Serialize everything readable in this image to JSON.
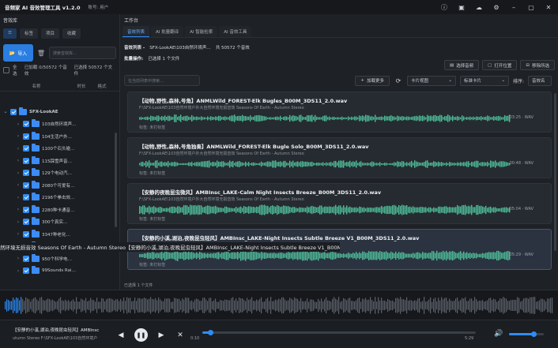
{
  "titlebar": {
    "title": "音频家 AI 音效管理工具 v1.2.0",
    "user": "账号: 用户",
    "icons": [
      "info-icon",
      "window-icon",
      "chat-icon",
      "gear-icon",
      "minimize-icon",
      "maximize-icon",
      "close-icon"
    ]
  },
  "left": {
    "panel_title": "音效库",
    "tabs": [
      "标签",
      "项目",
      "收藏"
    ],
    "import_label": "导入",
    "search_placeholder": "搜索音效库…",
    "select_all_label": "全选",
    "selection_info": "已加载 0/50572 个音效",
    "selection_info2": "已选择 50572 个文件",
    "columns": [
      "名称",
      "时长",
      "格式"
    ],
    "tree": {
      "root": "SFX-LookAE",
      "children": [
        "103自然环境声…",
        "104生活户外…",
        "1100个石头碰…",
        "115踩雪声音…",
        "129个电动汽…",
        "2080个可爱有…",
        "2196个拳击效…",
        "2280种卡通音…",
        "300个真实…",
        "3347种老化…",
        "93 Doors 210…",
        "950个科学电…",
        "99Sounds Rai…"
      ]
    }
  },
  "right": {
    "panel_title": "工作台",
    "tabs": [
      "音效列表",
      "AI 批量翻译",
      "AI 智能检索",
      "AI 音效工具"
    ],
    "info_label": "音效列表 -",
    "info_path": "SFX-LookAE\\103自然环境声…",
    "info_count": "共 50572 个音效",
    "batch_label": "批量操作:",
    "batch_value": "已选择 1 个文件",
    "actions": [
      "选择音频",
      "打开位置",
      "移除所选"
    ],
    "search_placeholder": "在当前列表中搜索…",
    "load_more": "加载更多",
    "view_mode": "卡片视图",
    "card_size": "标准卡片",
    "sort_label": "排序:",
    "sort_value": "音效名",
    "cards": [
      {
        "title": "【动物,野性,森林,号角】ANMLWild_FOREST-Elk Bugles_B00M_3DS11_2.0.wav",
        "path": "F:\\SFX-LookAE\\103自然环境户外大自然环境无损音效 Seasons Of Earth - Autumn Stereo",
        "tag": "标签: 未打标签",
        "duration": "03:25 · WAV"
      },
      {
        "title": "【动物,野性,森林,号角独奏】ANMLWild_FOREST-Elk Bugle Solo_B00M_3DS11_2.0.wav",
        "path": "F:\\SFX-LookAE\\103自然环境户外大自然环境无损音效 Seasons Of Earth - Autumn Stereo",
        "tag": "标签: 未打标签",
        "duration": "00:48 · WAV"
      },
      {
        "title": "【安静的夜晚昆虫微风】AMBInsc_LAKE-Calm Night Insects Breeze_B00M_3DS11_2.0.wav",
        "path": "F:\\SFX-LookAE\\103自然环境户外大自然环境无损音效 Seasons Of Earth - Autumn Stereo",
        "tag": "标签: 未打标签",
        "duration": "05:04 · WAV"
      },
      {
        "title": "【安静的小溪,湖泊,夜晚昆虫轻风】AMBInsc_LAKE-Night Insects Subtle Breeze V1_B00M_3DS11_2.0.wav",
        "path": "F:\\SFX-LookAE\\103自然环境户外大自然环境无损音效 Seasons Of Earth - Autumn Stereo",
        "tag": "标签: 未打标签",
        "duration": "05:29 · WAV"
      }
    ],
    "selected_count": "已选择 1 个文件"
  },
  "overlay_text": "然环境无损音效 Seasons Of Earth - Autumn Stereo【安静的小溪,湖泊,夜晚昆虫轻风】AMBInsc_LAKE-Night Insects Subtle Breeze V1_B00M_3DS11_2.0.wav",
  "player": {
    "track": "【安静的小溪,湖泊,夜晚昆虫轻风】AMBInsc",
    "path": "utumn Stereo  F:\\SFX-LookAE\\103自然环境户",
    "time_current": "0:10",
    "time_total": "5:29",
    "progress": 0.03,
    "volume": 0.7
  },
  "colors": {
    "accent": "#2f8cf5",
    "wave": "#4fbf9a",
    "bg": "#1e2126"
  }
}
